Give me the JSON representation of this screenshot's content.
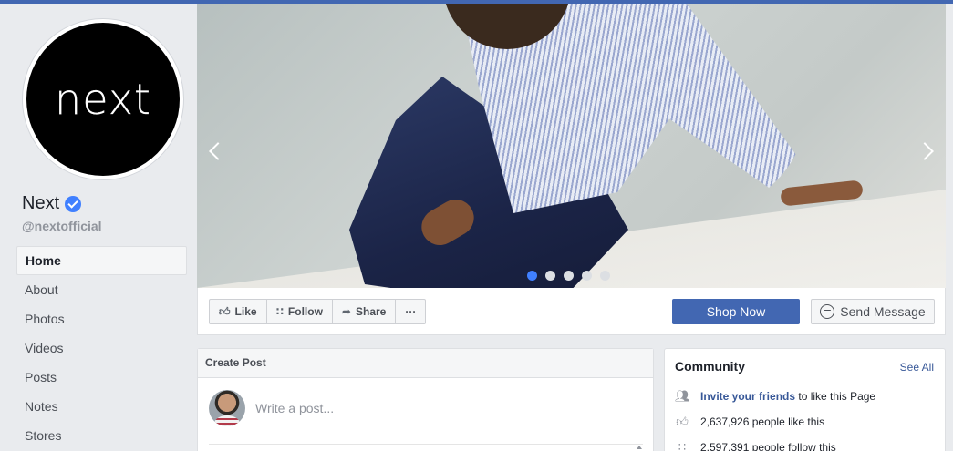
{
  "page": {
    "name": "Next",
    "handle": "@nextofficial",
    "logo_text": "next"
  },
  "nav": {
    "items": [
      {
        "label": "Home",
        "active": true
      },
      {
        "label": "About"
      },
      {
        "label": "Photos"
      },
      {
        "label": "Videos"
      },
      {
        "label": "Posts"
      },
      {
        "label": "Notes"
      },
      {
        "label": "Stores"
      }
    ]
  },
  "cover": {
    "slide_count": 5,
    "active_slide": 1
  },
  "actions": {
    "like": "Like",
    "follow": "Follow",
    "share": "Share",
    "more": "···",
    "shop_now": "Shop Now",
    "send_message": "Send Message"
  },
  "create_post": {
    "title": "Create Post",
    "placeholder": "Write a post..."
  },
  "community": {
    "title": "Community",
    "see_all": "See All",
    "invite_link": "Invite your friends",
    "invite_rest": "to like this Page",
    "likes": "2,637,926 people like this",
    "follows": "2,597,391 people follow this"
  },
  "colors": {
    "brand": "#4267b2",
    "link": "#385898",
    "verified": "#4080ff"
  }
}
